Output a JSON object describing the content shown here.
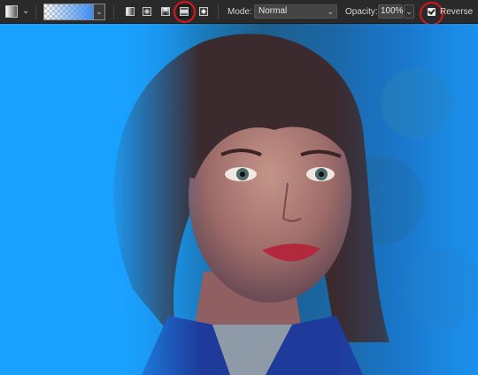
{
  "toolbar": {
    "mode_label": "Mode:",
    "mode_value": "Normal",
    "opacity_label": "Opacity:",
    "opacity_value": "100%",
    "reverse_label": "Reverse",
    "reverse_checked": true,
    "gradient_types": [
      "linear",
      "radial",
      "angle",
      "reflected",
      "diamond"
    ],
    "selected_gradient_type": "reflected",
    "highlight_color": "#e0151b"
  },
  "canvas": {
    "background_color": "#1aa0ff",
    "image_subject": "portrait photo with reflected blue gradient overlay"
  }
}
